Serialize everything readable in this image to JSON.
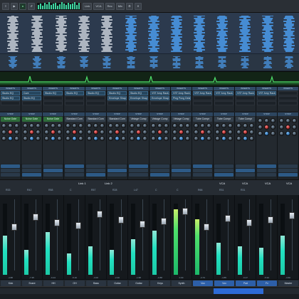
{
  "toolbar": {
    "buttons": [
      "",
      "",
      "",
      "",
      "",
      "",
      "",
      "",
      "",
      ""
    ],
    "labels": [
      "Link",
      "VCA",
      "Rec",
      "Mix"
    ]
  },
  "inserts": {
    "header": "INSERTS",
    "slots": [
      "Studio EQ",
      "Cure",
      "Studio EQ",
      "Studio EQ",
      "Studio EQ",
      "Studio EQ",
      "Studio EQ",
      "VST Amp Rack",
      "VST Amp Rack",
      "VST Amp Rack",
      "VST Amp Rack",
      "VST Amp Rack",
      "VST Amp Rack"
    ],
    "second_row": [
      "Studio EQ",
      "Studio EQ",
      "",
      "",
      "",
      "Envelope Shaper",
      "Envelope Shaper",
      "Envelope Shaper",
      "Ping Pong Delay"
    ]
  },
  "strip": {
    "header": "STRIP",
    "modules": [
      "Noise Gate",
      "Noise Gate",
      "Noise Gate",
      "Standard Com",
      "Standard Com",
      "Standard Com",
      "Vintage Comp",
      "Vintage Comp",
      "Vintage Comp",
      "Tube Compr",
      "Tube Compr",
      "Tube Compr"
    ]
  },
  "sends": {
    "header": "SENDS"
  },
  "linkrow": {
    "link1": "Link 1",
    "link2": "Link 2",
    "vca": "VCA",
    "values": [
      "R33",
      "R42",
      "R58",
      "C",
      "R57",
      "R28",
      "L47",
      "C",
      "C",
      "R66",
      "R31",
      "R31"
    ]
  },
  "faders": {
    "db_values": [
      "-4.88",
      "-7.35",
      "-6.24",
      "-5.16",
      "-3.00",
      "-2.40",
      "-1.58",
      "-0.88",
      "0.00",
      "-3.73",
      "-4.85",
      "-6.27",
      "-5.94",
      "-3.60"
    ]
  },
  "track_names": [
    "Kick",
    "Snare",
    "HH",
    "OH",
    "Bass",
    "Guitar",
    "Guitar",
    "Keys",
    "Synth",
    "Vox",
    "Vox",
    "Pad",
    "Fx",
    "Master"
  ],
  "colors": {
    "accent": "#3fd6a0",
    "insert_blue": "#26465e",
    "gate_green": "#2e6b3a",
    "meter": "#21e0c0"
  }
}
